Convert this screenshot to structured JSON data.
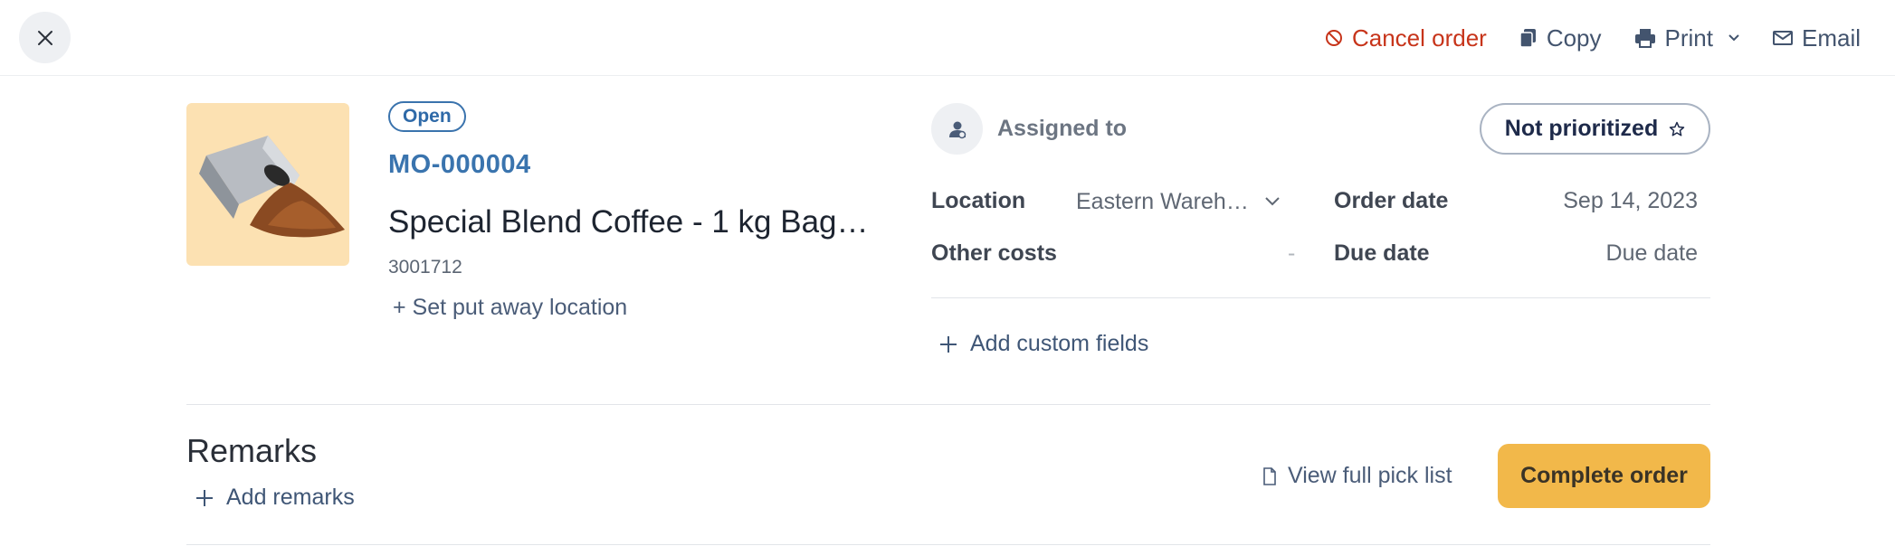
{
  "toolbar": {
    "close_icon": "close-icon",
    "actions": [
      {
        "label": "Cancel order",
        "icon": "cancel-icon",
        "color": "#c7341a"
      },
      {
        "label": "Copy",
        "icon": "copy-icon"
      },
      {
        "label": "Print",
        "icon": "printer-icon"
      },
      {
        "label": "Email",
        "icon": "mail-icon"
      }
    ]
  },
  "order": {
    "status": "Open",
    "number": "MO-000004",
    "product_name": "Special Blend Coffee - 1 kg Bag - …",
    "sku": "3001712",
    "set_location_label": "+ Set put away location",
    "image_icon": "coffee-bag-image"
  },
  "details": {
    "assigned_label": "Assigned to",
    "priority_label": "Not prioritized",
    "location_label": "Location",
    "location_value": "Eastern Wareho…",
    "order_date_label": "Order date",
    "order_date_value": "Sep 14, 2023",
    "other_costs_label": "Other costs",
    "other_costs_value": "-",
    "due_date_label": "Due date",
    "due_date_value": "Due date",
    "add_custom_label": "Add custom fields"
  },
  "remarks": {
    "title": "Remarks",
    "add_label": "Add remarks"
  },
  "footer": {
    "pick_list_label": "View full pick list",
    "complete_label": "Complete order",
    "accent_color": "#f2b84a"
  }
}
